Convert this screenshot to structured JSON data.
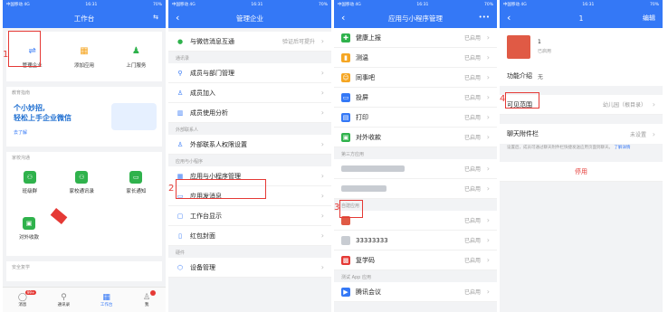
{
  "status": {
    "carrier": "中国移动 4G",
    "time": "16:31",
    "battery": "70%"
  },
  "p1": {
    "title": "工作台",
    "apps": [
      "管理企业",
      "添加应用",
      "上门服务"
    ],
    "tips_header": "教育指南",
    "tip_line1": "个小妙招,",
    "tip_line2": "轻松上手企业微信",
    "tip_link": "去了解",
    "home_header": "家校沟通",
    "home_apps": [
      "班级群",
      "家校通讯录",
      "家长通知"
    ],
    "extra_app": "对外收款",
    "safety_header": "安全复学",
    "tabs": [
      "消息",
      "通讯录",
      "工作台",
      "我"
    ],
    "badge_red": "99+",
    "marker": "1"
  },
  "p2": {
    "title": "管理企业",
    "top_row": "与微信消息互通",
    "top_row_value": "验证后可提升",
    "sec1": "通讯录",
    "rows1": [
      "成员与部门管理",
      "成员加入",
      "成员使用分析"
    ],
    "sec2": "外部联系人",
    "rows2": [
      "外部联系人权限设置"
    ],
    "sec3": "应用与小程序",
    "rows3": [
      "应用与小程序管理",
      "应用发消息",
      "工作台显示",
      "红包封面"
    ],
    "sec4": "硬件",
    "rows4": [
      "设备管理"
    ],
    "marker": "2"
  },
  "p3": {
    "title": "应用与小程序管理",
    "more": "•••",
    "apps": [
      "健康上报",
      "测温",
      "同事吧",
      "投屏",
      "打印",
      "对外收款"
    ],
    "enabled": "已启用",
    "sec_third": "第三方应用",
    "sec_self": "自建应用",
    "self_apps": [
      "33333333",
      "复学码"
    ],
    "sec_hidden": "测试 App 应用",
    "meeting": "腾讯会议",
    "marker": "3"
  },
  "p4": {
    "title": "1",
    "edit": "编辑",
    "app_name": "1",
    "app_status": "已启用",
    "intro_label": "功能介绍",
    "intro_value": "无",
    "scope_label": "可见范围",
    "scope_value": "幼儿园（根目录）",
    "attach_label": "聊天附件栏",
    "attach_value": "未设置",
    "attach_desc": "设置后，成员可通过聊天附件栏快捷发送应用页面到聊天。",
    "attach_link": "了解详情",
    "disable": "停用",
    "marker": "4"
  }
}
